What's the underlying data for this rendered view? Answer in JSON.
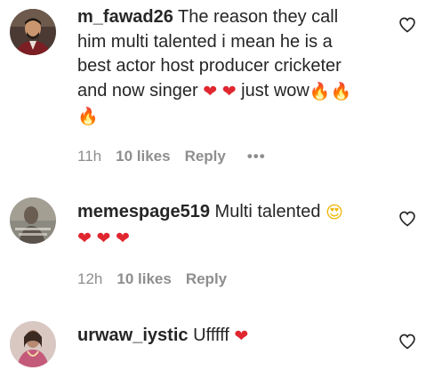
{
  "comments": [
    {
      "username": "m_fawad26",
      "text_line1": " The reason they call",
      "text_line2": "him multi talented i mean he is a",
      "text_line3": "best actor host producer cricketer",
      "text_line4a": "and now singer ",
      "text_line4b": " just wow",
      "time": "11h",
      "likes": "10 likes",
      "reply": "Reply",
      "more": "•••",
      "avatar_icon": "profile-photo",
      "heart_color": "#e0262f"
    },
    {
      "username": "memespage519",
      "text": " Multi talented ",
      "time": "12h",
      "likes": "10 likes",
      "reply": "Reply",
      "avatar_icon": "profile-photo"
    },
    {
      "username": "urwaw_iystic",
      "text": " Ufffff ",
      "avatar_icon": "profile-photo"
    }
  ],
  "icons": {
    "heart_emoji": "❤",
    "fire_emoji": "🔥",
    "heart_eyes_emoji": "😍",
    "like_icon": "heart-outline-icon"
  }
}
